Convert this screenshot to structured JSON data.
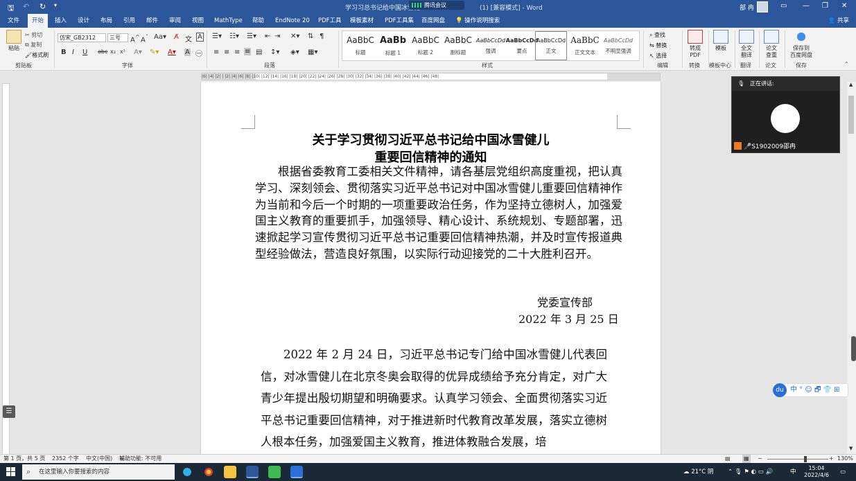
{
  "titlebar": {
    "title": "学习习总书记给中国冰雪健",
    "title_suffix": "(1) [兼容模式] - Word",
    "meeting_badge": "腾讯会议",
    "user": "部 冉"
  },
  "tabs": [
    "文件",
    "开始",
    "插入",
    "设计",
    "布局",
    "引用",
    "邮件",
    "审阅",
    "视图",
    "MathType",
    "帮助",
    "EndNote 20",
    "PDF工具",
    "模板素材",
    "PDF工具集",
    "百度网盘",
    "操作说明搜索"
  ],
  "share_label": "共享",
  "ribbon": {
    "clipboard": {
      "paste": "粘贴",
      "cut": "剪切",
      "copy": "复制",
      "format_painter": "格式刷",
      "label": "剪贴板"
    },
    "font": {
      "name": "仿宋_GB2312",
      "size": "三号",
      "label": "字体"
    },
    "paragraph": {
      "label": "段落"
    },
    "styles": {
      "label": "样式",
      "items": [
        {
          "sample": "AaBbC",
          "name": "标题"
        },
        {
          "sample": "AaBb",
          "name": "标题 1"
        },
        {
          "sample": "AaBbC",
          "name": "标题 2"
        },
        {
          "sample": "AaBbC",
          "name": "副标题"
        },
        {
          "sample": "AaBbCcDd",
          "name": "强调"
        },
        {
          "sample": "AaBbCcDd",
          "name": "要点"
        },
        {
          "sample": "AaBbCcDd",
          "name": "正文"
        },
        {
          "sample": "AaBbC",
          "name": "正文文本"
        },
        {
          "sample": "AaBbCcDd",
          "name": "不明显强调"
        }
      ]
    },
    "editing": {
      "find": "查找",
      "replace": "替换",
      "select": "选择",
      "label": "编辑"
    },
    "convert": {
      "l1": "转成",
      "l2": "PDF",
      "label": "转换"
    },
    "template": {
      "name": "模板",
      "label": "模板中心"
    },
    "translate": {
      "l1": "全文",
      "l2": "翻译",
      "label": "翻译"
    },
    "paper": {
      "l1": "论文",
      "l2": "查重",
      "label": "论文"
    },
    "save": {
      "l1": "保存到",
      "l2": "百度网盘",
      "label": "保存"
    }
  },
  "ruler_text": "|6| |4| |2| | |2| |4| |6| |8| |10| |12| |14| |16| |18| |20| |22| |24| |26| |28| |30| |32| |34| |36| |38| |40| |42| |44| |46| |48|",
  "document": {
    "title_line1": "关于学习贯彻习近平总书记给中国冰雪健儿",
    "title_line2": "重要回信精神的通知",
    "para1": "根据省委教育工委相关文件精神，请各基层党组织高度重视，把认真学习、深刻领会、贯彻落实习近平总书记对中国冰雪健儿重要回信精神作为当前和今后一个时期的一项重要政治任务，作为坚持立德树人，加强爱国主义教育的重要抓手，加强领导、精心设计、系统规划、专题部署，迅速掀起学习宣传贯彻习近平总书记重要回信精神热潮，并及时宣传报道典型经验做法，营造良好氛围，以实际行动迎接党的二十大胜利召开。",
    "sign_org": "党委宣传部",
    "sign_date": "2022 年 3 月 25 日",
    "para2": "2022 年 2 月 24 日，习近平总书记专门给中国冰雪健儿代表回信，对冰雪健儿在北京冬奥会取得的优异成绩给予充分肯定，对广大青少年提出殷切期望和明确要求。认真学习领会、全面贯彻落实习近平总书记重要回信精神，对于推进新时代教育改革发展，落实立德树人根本任务，加强爱国主义教育，推进体教融合发展，培"
  },
  "meeting": {
    "speaking": "正在讲话:",
    "participant": "S1902009邵冉"
  },
  "ime": {
    "du": "du",
    "chars": "中 ° ☺ 🗗 👕 ⊞"
  },
  "status": {
    "page": "第 1 页，共 5 页",
    "words": "2352 个字",
    "lang": "中文(中国)",
    "access": "辅助功能: 不可用",
    "zoom": "130%"
  },
  "taskbar": {
    "search_placeholder": "在这里输入你要搜索的内容",
    "weather": "21°C 阴",
    "ime": "中",
    "time": "15:04",
    "date": "2022/4/6"
  },
  "colors": {
    "accent": "#2b579a",
    "taskbar": "#1b2836",
    "meeting_orange": "#f07a1e"
  }
}
